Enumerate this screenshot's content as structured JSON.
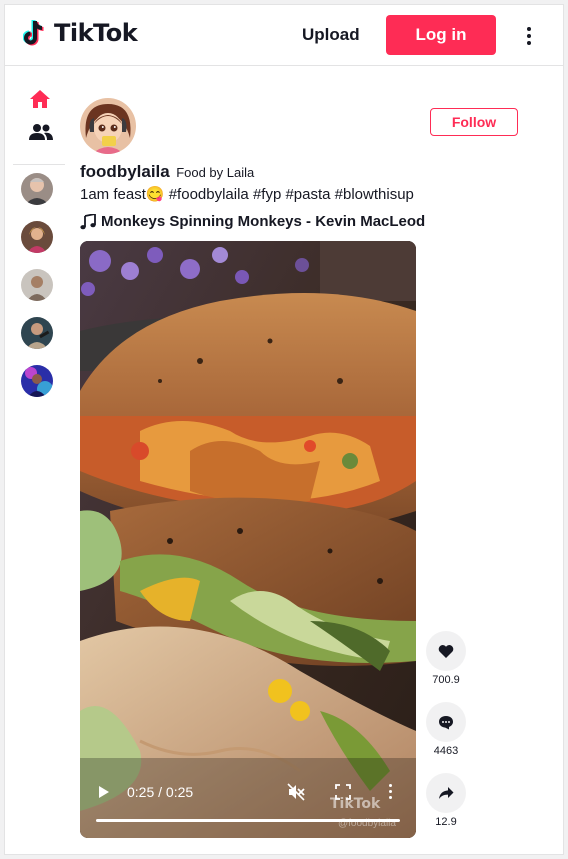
{
  "header": {
    "logo_text": "TikTok",
    "upload_label": "Upload",
    "login_label": "Log in",
    "more_icon": "vertical-ellipsis-icon"
  },
  "colors": {
    "brand": "#fe2c55",
    "text": "#161823",
    "divider": "#e3e3e4",
    "action_bg": "#f1f1f2"
  },
  "sidebar": {
    "nav": [
      {
        "name": "home",
        "icon": "home-icon",
        "active": true
      },
      {
        "name": "following",
        "icon": "people-icon",
        "active": false
      }
    ],
    "suggested_accounts_count": 5
  },
  "post": {
    "unique_id": "foodbylaila",
    "nickname": "Food by Laila",
    "follow_label": "Follow",
    "caption": "1am feast😋 #foodbylaila #fyp #pasta #blowthisup",
    "music": "Monkeys Spinning Monkeys - Kevin MacLeod",
    "video": {
      "time": "0:25 / 0:25",
      "progress": 1.0,
      "muted": true,
      "watermark": "TikTok",
      "watermark_handle": "@foodbylaila"
    },
    "actions": {
      "likes": "700.9",
      "comments": "4463",
      "shares": "12.9"
    }
  }
}
